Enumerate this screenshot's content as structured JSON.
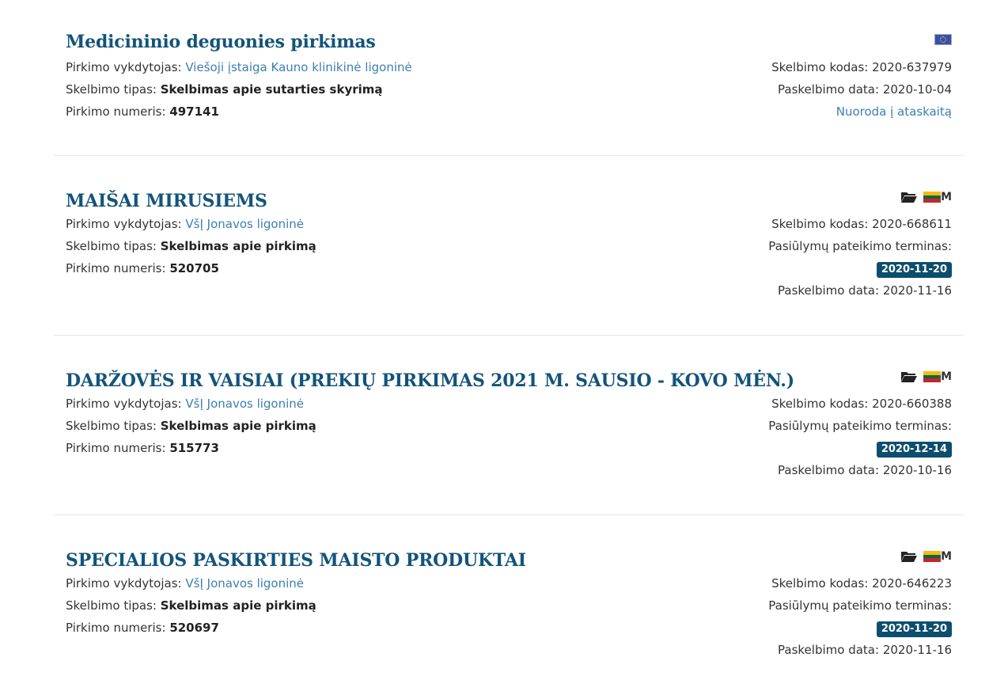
{
  "labels": {
    "executor": "Pirkimo vykdytojas:",
    "type": "Skelbimo tipas:",
    "number": "Pirkimo numeris:",
    "code": "Skelbimo kodas:",
    "deadline": "Pasiūlymų pateikimo terminas:",
    "published": "Paskelbimo data:"
  },
  "items": [
    {
      "title": "Medicininio deguonies pirkimas",
      "executor": "Viešoji įstaiga Kauno klinikinė ligoninė",
      "type": "Skelbimas apie sutarties skyrimą",
      "number": "497141",
      "code": "2020-637979",
      "published": "2020-10-04",
      "report_link": "Nuoroda į ataskaitą",
      "icons": [
        "eu-flag-icon"
      ]
    },
    {
      "title": "MAIŠAI MIRUSIEMS",
      "executor": "VšĮ Jonavos ligoninė",
      "type": "Skelbimas apie pirkimą",
      "number": "520705",
      "code": "2020-668611",
      "deadline": "2020-11-20",
      "published": "2020-11-16",
      "icons": [
        "folder-icon",
        "lt-flag-icon",
        "m-icon"
      ],
      "m_text": "M"
    },
    {
      "title": "DARŽOVĖS IR VAISIAI (PREKIŲ PIRKIMAS 2021 M. SAUSIO - KOVO MĖN.)",
      "executor": "VšĮ Jonavos ligoninė",
      "type": "Skelbimas apie pirkimą",
      "number": "515773",
      "code": "2020-660388",
      "deadline": "2020-12-14",
      "published": "2020-10-16",
      "icons": [
        "folder-icon",
        "lt-flag-icon",
        "m-icon"
      ],
      "m_text": "M"
    },
    {
      "title": "SPECIALIOS PASKIRTIES MAISTO PRODUKTAI",
      "executor": "VšĮ Jonavos ligoninė",
      "type": "Skelbimas apie pirkimą",
      "number": "520697",
      "code": "2020-646223",
      "deadline": "2020-11-20",
      "published": "2020-11-16",
      "icons": [
        "folder-icon",
        "lt-flag-icon",
        "m-icon"
      ],
      "m_text": "M"
    }
  ],
  "colors": {
    "title": "#13547a",
    "link": "#3d7fb0",
    "badge": "#0d4e6e",
    "lt_yellow": "#fdb913",
    "lt_green": "#006a44",
    "lt_red": "#c1272d"
  }
}
